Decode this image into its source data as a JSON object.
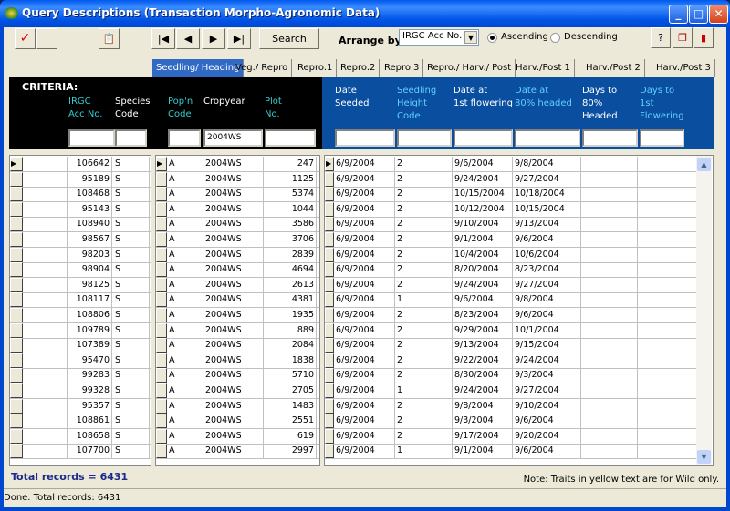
{
  "window": {
    "title": "Query Descriptions (Transaction Morpho-Agronomic Data)"
  },
  "toolbar": {
    "search_label": "Search",
    "arrange_label": "Arrange by:",
    "arrange_value": "IRGC Acc No.",
    "ascending": "Ascending",
    "descending": "Descending",
    "sort_order": "ascending"
  },
  "tabs": [
    {
      "label": "Seedling/ Heading",
      "active": true
    },
    {
      "label": "Veg./ Repro"
    },
    {
      "label": "Repro.1"
    },
    {
      "label": "Repro.2"
    },
    {
      "label": "Repro.3"
    },
    {
      "label": "Repro./ Harv./ Post"
    },
    {
      "label": "Harv./Post 1"
    },
    {
      "label": "Harv./Post 2"
    },
    {
      "label": "Harv./Post 3"
    }
  ],
  "criteria": {
    "title": "CRITERIA:",
    "headers": [
      {
        "label": "IRGC\nAcc No.",
        "color": "#33cccc"
      },
      {
        "label": "Species\nCode",
        "color": "#ffffff"
      },
      {
        "label": "Pop'n\nCode",
        "color": "#33cccc"
      },
      {
        "label": "Cropyear",
        "color": "#ffffff"
      },
      {
        "label": "Plot\nNo.",
        "color": "#33cccc"
      },
      {
        "label": "Date\nSeeded",
        "color": "#ffffff"
      },
      {
        "label": "Seedling\nHeight\nCode",
        "color": "#5fd0ff"
      },
      {
        "label": "Date at\n1st flowering",
        "color": "#ffffff"
      },
      {
        "label": "Date at\n80% headed",
        "color": "#5fd0ff"
      },
      {
        "label": "Days to\n80%\nHeaded",
        "color": "#ffffff"
      },
      {
        "label": "Days to\n1st\nFlowering",
        "color": "#5fd0ff"
      }
    ],
    "values": [
      "",
      "",
      "",
      "2004WS",
      "",
      "",
      "",
      "",
      "",
      "",
      ""
    ]
  },
  "rows": [
    [
      "106642",
      "S",
      "A",
      "2004WS",
      "247",
      "6/9/2004",
      "2",
      "9/6/2004",
      "9/8/2004"
    ],
    [
      "95189",
      "S",
      "A",
      "2004WS",
      "1125",
      "6/9/2004",
      "2",
      "9/24/2004",
      "9/27/2004"
    ],
    [
      "108468",
      "S",
      "A",
      "2004WS",
      "5374",
      "6/9/2004",
      "2",
      "10/15/2004",
      "10/18/2004"
    ],
    [
      "95143",
      "S",
      "A",
      "2004WS",
      "1044",
      "6/9/2004",
      "2",
      "10/12/2004",
      "10/15/2004"
    ],
    [
      "108940",
      "S",
      "A",
      "2004WS",
      "3586",
      "6/9/2004",
      "2",
      "9/10/2004",
      "9/13/2004"
    ],
    [
      "98567",
      "S",
      "A",
      "2004WS",
      "3706",
      "6/9/2004",
      "2",
      "9/1/2004",
      "9/6/2004"
    ],
    [
      "98203",
      "S",
      "A",
      "2004WS",
      "2839",
      "6/9/2004",
      "2",
      "10/4/2004",
      "10/6/2004"
    ],
    [
      "98904",
      "S",
      "A",
      "2004WS",
      "4694",
      "6/9/2004",
      "2",
      "8/20/2004",
      "8/23/2004"
    ],
    [
      "98125",
      "S",
      "A",
      "2004WS",
      "2613",
      "6/9/2004",
      "2",
      "9/24/2004",
      "9/27/2004"
    ],
    [
      "108117",
      "S",
      "A",
      "2004WS",
      "4381",
      "6/9/2004",
      "1",
      "9/6/2004",
      "9/8/2004"
    ],
    [
      "108806",
      "S",
      "A",
      "2004WS",
      "1935",
      "6/9/2004",
      "2",
      "8/23/2004",
      "9/6/2004"
    ],
    [
      "109789",
      "S",
      "A",
      "2004WS",
      "889",
      "6/9/2004",
      "2",
      "9/29/2004",
      "10/1/2004"
    ],
    [
      "107389",
      "S",
      "A",
      "2004WS",
      "2084",
      "6/9/2004",
      "2",
      "9/13/2004",
      "9/15/2004"
    ],
    [
      "95470",
      "S",
      "A",
      "2004WS",
      "1838",
      "6/9/2004",
      "2",
      "9/22/2004",
      "9/24/2004"
    ],
    [
      "99283",
      "S",
      "A",
      "2004WS",
      "5710",
      "6/9/2004",
      "2",
      "8/30/2004",
      "9/3/2004"
    ],
    [
      "99328",
      "S",
      "A",
      "2004WS",
      "2705",
      "6/9/2004",
      "1",
      "9/24/2004",
      "9/27/2004"
    ],
    [
      "95357",
      "S",
      "A",
      "2004WS",
      "1483",
      "6/9/2004",
      "2",
      "9/8/2004",
      "9/10/2004"
    ],
    [
      "108861",
      "S",
      "A",
      "2004WS",
      "2551",
      "6/9/2004",
      "2",
      "9/3/2004",
      "9/6/2004"
    ],
    [
      "108658",
      "S",
      "A",
      "2004WS",
      "619",
      "6/9/2004",
      "2",
      "9/17/2004",
      "9/20/2004"
    ],
    [
      "107700",
      "S",
      "A",
      "2004WS",
      "2997",
      "6/9/2004",
      "1",
      "9/1/2004",
      "9/6/2004"
    ]
  ],
  "footer": {
    "total": "Total records = 6431",
    "note": "Note: Traits in yellow text are for Wild only."
  },
  "status": {
    "text": "Done. Total records: 6431"
  },
  "colors": {
    "criteria_black": "#000000",
    "criteria_blue": "#0a4ea0",
    "active_tab": "#316ac5",
    "total_text": "#1a2a8a"
  }
}
